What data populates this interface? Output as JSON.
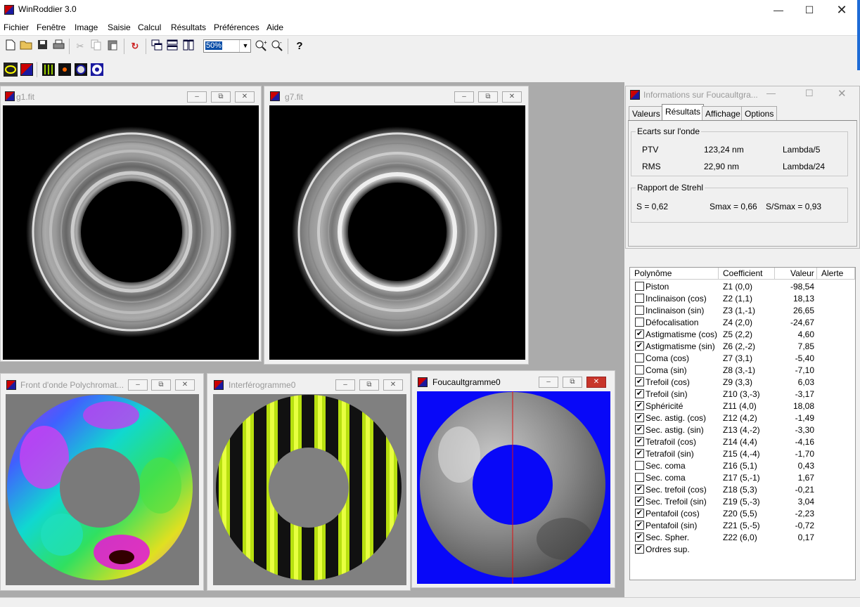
{
  "app": {
    "title": "WinRoddier 3.0"
  },
  "menu": [
    "Fichier",
    "Fenêtre",
    "Image",
    "Saisie",
    "Calcul",
    "Résultats",
    "Préférences",
    "Aide"
  ],
  "toolbar": {
    "zoom": "50%"
  },
  "windows": {
    "g1": {
      "title": "g1.fit"
    },
    "g7": {
      "title": "g7.fit"
    },
    "front": {
      "title": "Front d'onde Polychromat..."
    },
    "interf": {
      "title": "Interférogramme0"
    },
    "foucault": {
      "title": "Foucaultgramme0"
    }
  },
  "info": {
    "title": "Informations sur Foucaultgra...",
    "tabs": [
      "Valeurs",
      "Résultats",
      "Affichage",
      "Options"
    ],
    "active_tab": "Résultats",
    "ecarts": {
      "label": "Ecarts sur l'onde",
      "ptv_label": "PTV",
      "ptv_value": "123,24 nm",
      "ptv_lambda": "Lambda/5",
      "rms_label": "RMS",
      "rms_value": "22,90 nm",
      "rms_lambda": "Lambda/24"
    },
    "strehl": {
      "label": "Rapport de Strehl",
      "s": "S = 0,62",
      "smax": "Smax = 0,66",
      "ratio": "S/Smax = 0,93"
    }
  },
  "coefficients": {
    "headers": [
      "Polynôme",
      "Coefficient",
      "Valeur",
      "Alerte"
    ],
    "rows": [
      {
        "name": "Piston",
        "coef": "Z1 (0,0)",
        "value": "-98,54",
        "checked": false
      },
      {
        "name": "Inclinaison (cos)",
        "coef": "Z2 (1,1)",
        "value": "18,13",
        "checked": false
      },
      {
        "name": "Inclinaison (sin)",
        "coef": "Z3 (1,-1)",
        "value": "26,65",
        "checked": false
      },
      {
        "name": "Défocalisation",
        "coef": "Z4 (2,0)",
        "value": "-24,67",
        "checked": false
      },
      {
        "name": "Astigmatisme (cos)",
        "coef": "Z5 (2,2)",
        "value": "4,60",
        "checked": true
      },
      {
        "name": "Astigmatisme (sin)",
        "coef": "Z6 (2,-2)",
        "value": "7,85",
        "checked": true
      },
      {
        "name": "Coma (cos)",
        "coef": "Z7 (3,1)",
        "value": "-5,40",
        "checked": false
      },
      {
        "name": "Coma (sin)",
        "coef": "Z8 (3,-1)",
        "value": "-7,10",
        "checked": false
      },
      {
        "name": "Trefoil (cos)",
        "coef": "Z9 (3,3)",
        "value": "6,03",
        "checked": true
      },
      {
        "name": "Trefoil (sin)",
        "coef": "Z10 (3,-3)",
        "value": "-3,17",
        "checked": true
      },
      {
        "name": "Sphéricité",
        "coef": "Z11 (4,0)",
        "value": "18,08",
        "checked": true
      },
      {
        "name": "Sec. astig. (cos)",
        "coef": "Z12 (4,2)",
        "value": "-1,49",
        "checked": true
      },
      {
        "name": "Sec. astig. (sin)",
        "coef": "Z13 (4,-2)",
        "value": "-3,30",
        "checked": true
      },
      {
        "name": "Tetrafoil (cos)",
        "coef": "Z14 (4,4)",
        "value": "-4,16",
        "checked": true
      },
      {
        "name": "Tetrafoil (sin)",
        "coef": "Z15 (4,-4)",
        "value": "-1,70",
        "checked": true
      },
      {
        "name": "Sec. coma",
        "coef": "Z16 (5,1)",
        "value": "0,43",
        "checked": false
      },
      {
        "name": "Sec. coma",
        "coef": "Z17 (5,-1)",
        "value": "1,67",
        "checked": false
      },
      {
        "name": "Sec. trefoil (cos)",
        "coef": "Z18 (5,3)",
        "value": "-0,21",
        "checked": true
      },
      {
        "name": "Sec. Trefoil (sin)",
        "coef": "Z19 (5,-3)",
        "value": "3,04",
        "checked": true
      },
      {
        "name": "Pentafoil (cos)",
        "coef": "Z20 (5,5)",
        "value": "-2,23",
        "checked": true
      },
      {
        "name": "Pentafoil (sin)",
        "coef": "Z21 (5,-5)",
        "value": "-0,72",
        "checked": true
      },
      {
        "name": "Sec. Spher.",
        "coef": "Z22 (6,0)",
        "value": "0,17",
        "checked": true
      },
      {
        "name": "Ordres sup.",
        "coef": "",
        "value": "",
        "checked": true
      }
    ]
  }
}
